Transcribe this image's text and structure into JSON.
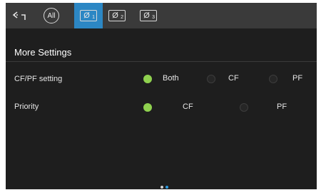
{
  "topbar": {
    "all_label": "All",
    "phases": [
      {
        "symbol": "Ø",
        "sub": "1",
        "selected": true
      },
      {
        "symbol": "Ø",
        "sub": "2",
        "selected": false
      },
      {
        "symbol": "Ø",
        "sub": "3",
        "selected": false
      }
    ],
    "accent_color": "#2c87c4"
  },
  "page": {
    "title": "More Settings"
  },
  "settings": {
    "cfpf": {
      "label": "CF/PF setting",
      "options": [
        {
          "label": "Both",
          "selected": true
        },
        {
          "label": "CF",
          "selected": false
        },
        {
          "label": "PF",
          "selected": false
        }
      ]
    },
    "priority": {
      "label": "Priority",
      "options": [
        {
          "label": "CF",
          "selected": true
        },
        {
          "label": "PF",
          "selected": false
        }
      ]
    }
  },
  "pagination": {
    "pages": 2,
    "current": 2
  },
  "colors": {
    "radio_on": "#8fd14f"
  }
}
